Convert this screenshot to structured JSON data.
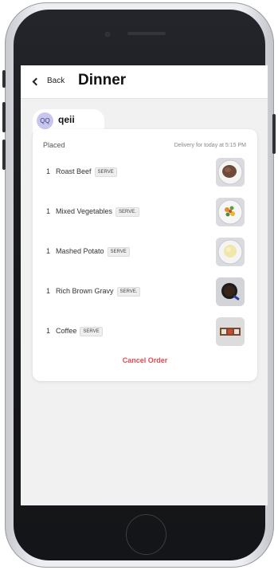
{
  "header": {
    "back_label": "Back",
    "title": "Dinner"
  },
  "user": {
    "initials": "QQ",
    "name": "qeii"
  },
  "order": {
    "status": "Placed",
    "delivery": "Delivery for today at 5:15 PM",
    "items": [
      {
        "qty": "1",
        "name": "Roast Beef",
        "tag": "SERVE"
      },
      {
        "qty": "1",
        "name": "Mixed Vegetables",
        "tag": "SERVE."
      },
      {
        "qty": "1",
        "name": "Mashed Potato",
        "tag": "SERVE"
      },
      {
        "qty": "1",
        "name": "Rich Brown Gravy",
        "tag": "SERVE."
      },
      {
        "qty": "1",
        "name": "Coffee",
        "tag": "SERVE"
      }
    ],
    "cancel_label": "Cancel Order"
  },
  "colors": {
    "accent_cancel": "#e5484d",
    "avatar_bg": "#c9c6ee",
    "screen_bg": "#f1f1f1"
  },
  "icons": {
    "back": "chevron-left-icon",
    "home": "home-button-icon"
  }
}
